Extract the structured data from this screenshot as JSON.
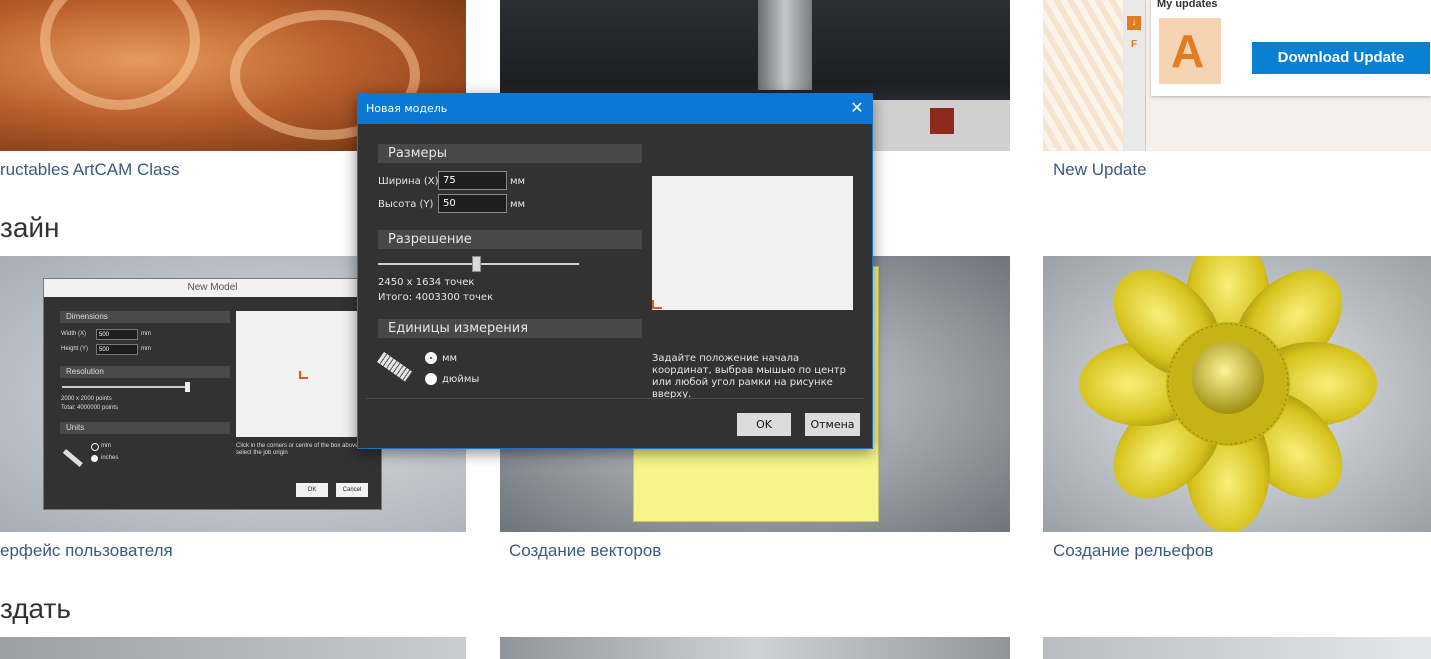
{
  "cards": {
    "top": [
      {
        "caption": "ructables ArtCAM Class"
      },
      {
        "caption": ""
      },
      {
        "caption": "New Update",
        "panel_title": "My updates",
        "button": "Download Update",
        "logo_letter": "A"
      }
    ],
    "middle": [
      {
        "caption": "ерфейс пользователя"
      },
      {
        "caption": "Создание векторов"
      },
      {
        "caption": "Создание рельефов"
      }
    ]
  },
  "sections": {
    "design": "зайн",
    "create": "здать"
  },
  "thumbnail_new_model": {
    "title": "New Model",
    "dimensions": "Dimensions",
    "width_label": "Width (X)",
    "width_value": "500",
    "width_unit": "mm",
    "height_label": "Height (Y)",
    "height_value": "500",
    "height_unit": "mm",
    "resolution": "Resolution",
    "points": "2000 x 2000 points",
    "total": "Total: 4000000 points",
    "units": "Units",
    "unit_mm": "mm",
    "unit_inches": "inches",
    "hint": "Click in the corners or centre of the box above to select the job origin",
    "ok": "OK",
    "cancel": "Cancel"
  },
  "dialog": {
    "title": "Новая модель",
    "close_glyph": "✕",
    "dimensions_header": "Размеры",
    "width_label": "Ширина (X)",
    "width_value": "75",
    "width_unit": "мм",
    "height_label": "Высота (Y)",
    "height_value": "50",
    "height_unit": "мм",
    "resolution_header": "Разрешение",
    "resolution_level": 0.49,
    "points": "2450 x 1634 точек",
    "total": "Итого: 4003300 точек",
    "units_header": "Единицы измерения",
    "unit_mm": "мм",
    "unit_inches": "дюймы",
    "selected_unit": "mm",
    "hint": "Задайте положение начала координат, выбрав мышью по центр или любой угол рамки на рисунке вверху.",
    "ok": "OK",
    "cancel": "Отмена"
  },
  "colors": {
    "dialog_title_bar": "#0a78d4",
    "dialog_body": "#323232",
    "origin_marker": "#e0581c",
    "caption_link": "#3b5a7f",
    "download_button": "#0a80d2"
  },
  "icons": [
    "close-icon",
    "ruler-icon",
    "autodesk-logo-icon"
  ]
}
